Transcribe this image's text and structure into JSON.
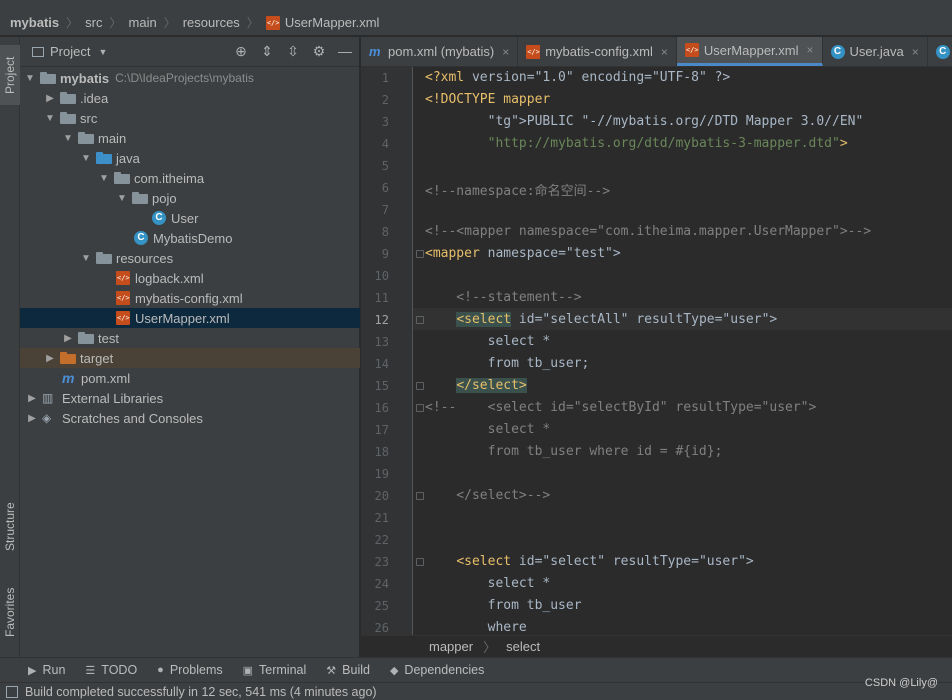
{
  "navbar": {
    "crumbs": [
      "mybatis",
      "src",
      "main",
      "resources",
      "UserMapper.xml"
    ]
  },
  "left_strip": {
    "project": "Project",
    "structure": "Structure",
    "favorites": "Favorites"
  },
  "project_panel": {
    "title": "Project",
    "tree": [
      {
        "label": "mybatis",
        "path": "C:\\D\\IdeaProjects\\mybatis"
      },
      {
        "label": ".idea"
      },
      {
        "label": "src"
      },
      {
        "label": "main"
      },
      {
        "label": "java"
      },
      {
        "label": "com.itheima"
      },
      {
        "label": "pojo"
      },
      {
        "label": "User"
      },
      {
        "label": "MybatisDemo"
      },
      {
        "label": "resources"
      },
      {
        "label": "logback.xml"
      },
      {
        "label": "mybatis-config.xml"
      },
      {
        "label": "UserMapper.xml"
      },
      {
        "label": "test"
      },
      {
        "label": "target"
      },
      {
        "label": "pom.xml"
      },
      {
        "label": "External Libraries"
      },
      {
        "label": "Scratches and Consoles"
      }
    ]
  },
  "tabs": [
    {
      "label": "pom.xml (mybatis)"
    },
    {
      "label": "mybatis-config.xml"
    },
    {
      "label": "UserMapper.xml"
    },
    {
      "label": "User.java"
    }
  ],
  "editor": {
    "line_numbers": [
      "1",
      "2",
      "3",
      "4",
      "5",
      "6",
      "7",
      "8",
      "9",
      "10",
      "11",
      "12",
      "13",
      "14",
      "15",
      "16",
      "17",
      "18",
      "19",
      "20",
      "21",
      "22",
      "23",
      "24",
      "25",
      "26"
    ],
    "lines": [
      "<?xml version=\"1.0\" encoding=\"UTF-8\" ?>",
      "<!DOCTYPE mapper",
      "        PUBLIC \"-//mybatis.org//DTD Mapper 3.0//EN\"",
      "        \"http://mybatis.org/dtd/mybatis-3-mapper.dtd\">",
      "",
      "<!--namespace:命名空间-->",
      "",
      "<!--<mapper namespace=\"com.itheima.mapper.UserMapper\">-->",
      "<mapper namespace=\"test\">",
      "",
      "    <!--statement-->",
      "    <select id=\"selectAll\" resultType=\"user\">",
      "        select *",
      "        from tb_user;",
      "    </select>",
      "<!--    <select id=\"selectById\" resultType=\"user\">",
      "        select *",
      "        from tb_user where id = #{id};",
      "",
      "    </select>-->",
      "",
      "",
      "    <select id=\"select\" resultType=\"user\">",
      "        select *",
      "        from tb_user",
      "        where"
    ]
  },
  "editor_breadcrumb": [
    "mapper",
    "select"
  ],
  "bottom_tools": [
    "Run",
    "TODO",
    "Problems",
    "Terminal",
    "Build",
    "Dependencies"
  ],
  "status": {
    "message": "Build completed successfully in 12 sec, 541 ms (4 minutes ago)"
  },
  "watermark": "CSDN @Lily@"
}
